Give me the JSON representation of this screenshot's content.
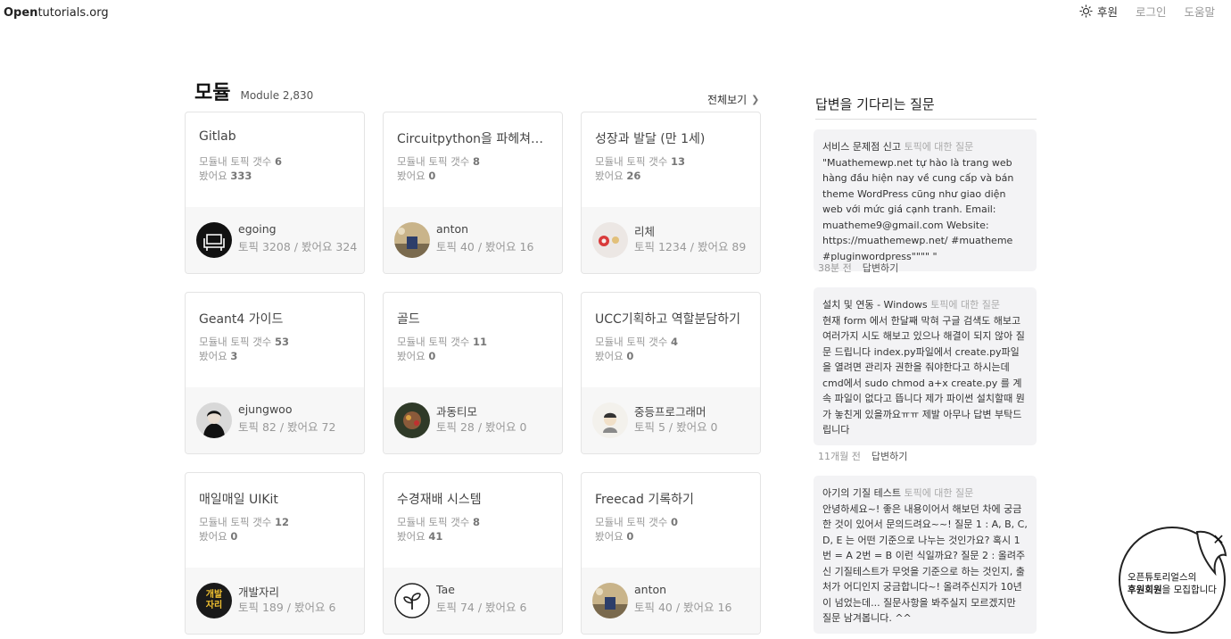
{
  "header": {
    "logo_bold": "Open",
    "logo_rest": "tutorials.org",
    "nav": {
      "sponsor": "후원",
      "login": "로그인",
      "help": "도움말"
    }
  },
  "modules": {
    "title": "모듈",
    "subtitle": "Module 2,830",
    "view_all": "전체보기",
    "topic_count_label": "모듈내 토픽 갯수",
    "views_label": "봤어요",
    "items": [
      {
        "title": "Gitlab",
        "topics": "6",
        "views": "333",
        "author": "egoing",
        "stats": "토픽 3208 / 봤어요 324",
        "avatar": "armchair-avatar"
      },
      {
        "title": "Circuitpython을 파헤쳐보...",
        "topics": "8",
        "views": "0",
        "author": "anton",
        "stats": "토픽 40 / 봤어요 16",
        "avatar": "desk-photo-avatar"
      },
      {
        "title": "성장과 발달 (만 1세)",
        "topics": "13",
        "views": "26",
        "author": "리체",
        "stats": "토픽 1234 / 봤어요 89",
        "avatar": "macaron-avatar"
      },
      {
        "title": "Geant4 가이드",
        "topics": "53",
        "views": "3",
        "author": "ejungwoo",
        "stats": "토픽 82 / 봤어요 72",
        "avatar": "person-avatar"
      },
      {
        "title": "골드",
        "topics": "11",
        "views": "0",
        "author": "과동티모",
        "stats": "토픽 28 / 봤어요 0",
        "avatar": "game-character-avatar"
      },
      {
        "title": "UCC기획하고 역할분담하기",
        "topics": "4",
        "views": "0",
        "author": "중등프로그래머",
        "stats": "토픽 5 / 봤어요 0",
        "avatar": "cartoon-avatar"
      },
      {
        "title": "매일매일 UIKit",
        "topics": "12",
        "views": "0",
        "author": "개발자리",
        "stats": "토픽 189 / 봤어요 6",
        "avatar": "logo-avatar",
        "avatar_text": "개발\n자리"
      },
      {
        "title": "수경재배 시스템",
        "topics": "8",
        "views": "41",
        "author": "Tae",
        "stats": "토픽 74 / 봤어요 6",
        "avatar": "sprout-avatar"
      },
      {
        "title": "Freecad 기록하기",
        "topics": "0",
        "views": "0",
        "author": "anton",
        "stats": "토픽 40 / 봤어요 16",
        "avatar": "desk-photo-avatar"
      }
    ]
  },
  "questions": {
    "title": "답변을 기다리는 질문",
    "ref_label": "토픽에 대한 질문",
    "answer_label": "답변하기",
    "items": [
      {
        "topic": "서비스 문제점 신고",
        "body": "\"Muathemewp.net tự hào là trang web hàng đầu hiện nay về cung cấp và bán theme WordPress cũng như giao diện web với mức giá cạnh tranh. Email: muatheme9@gmail.com Website: https://muathemewp.net/ #muatheme #pluginwordpress\"\"\"\" \"",
        "time": "38분 전"
      },
      {
        "topic": "설치 및 연동 - Windows",
        "body": "현재 form 에서 한달째 막혀 구글 검색도 해보고 여러가지 시도 해보고 있으나 해결이 되지 않아 질문 드립니다 index.py파일에서 create.py파일을 열려면 관리자 권한을 줘야한다고 하시는데 cmd에서 sudo chmod a+x create.py 를 계속 파일이 없다고 뜹니다 제가 파이썬 설치할때 뭔가 놓친게 있을까요ㅠㅠ 제발 아무나 답변 부탁드립니다",
        "time": "11개월 전"
      },
      {
        "topic": "아기의 기질 테스트",
        "body": "안녕하세요~! 좋은 내용이어서 해보던 차에 궁금한 것이 있어서 문의드려요~~! 질문 1 : A, B, C, D, E 는 어떤 기준으로 나누는 것인가요? 혹시 1번 = A 2번 = B 이런 식일까요? 질문 2 : 올려주신 기질테스트가 무엇을 기준으로 하는 것인지, 출처가 어디인지 궁금합니다~! 올려주신지가 10년이 넘었는데... 질문사항을 봐주실지 모르겠지만 질문 남겨봅니다. ^^",
        "time": ""
      }
    ]
  },
  "promo": {
    "line1": "오픈튜토리얼스의",
    "line2_bold": "후원회원",
    "line2_rest": "을 모집합니다",
    "close": "✕"
  }
}
